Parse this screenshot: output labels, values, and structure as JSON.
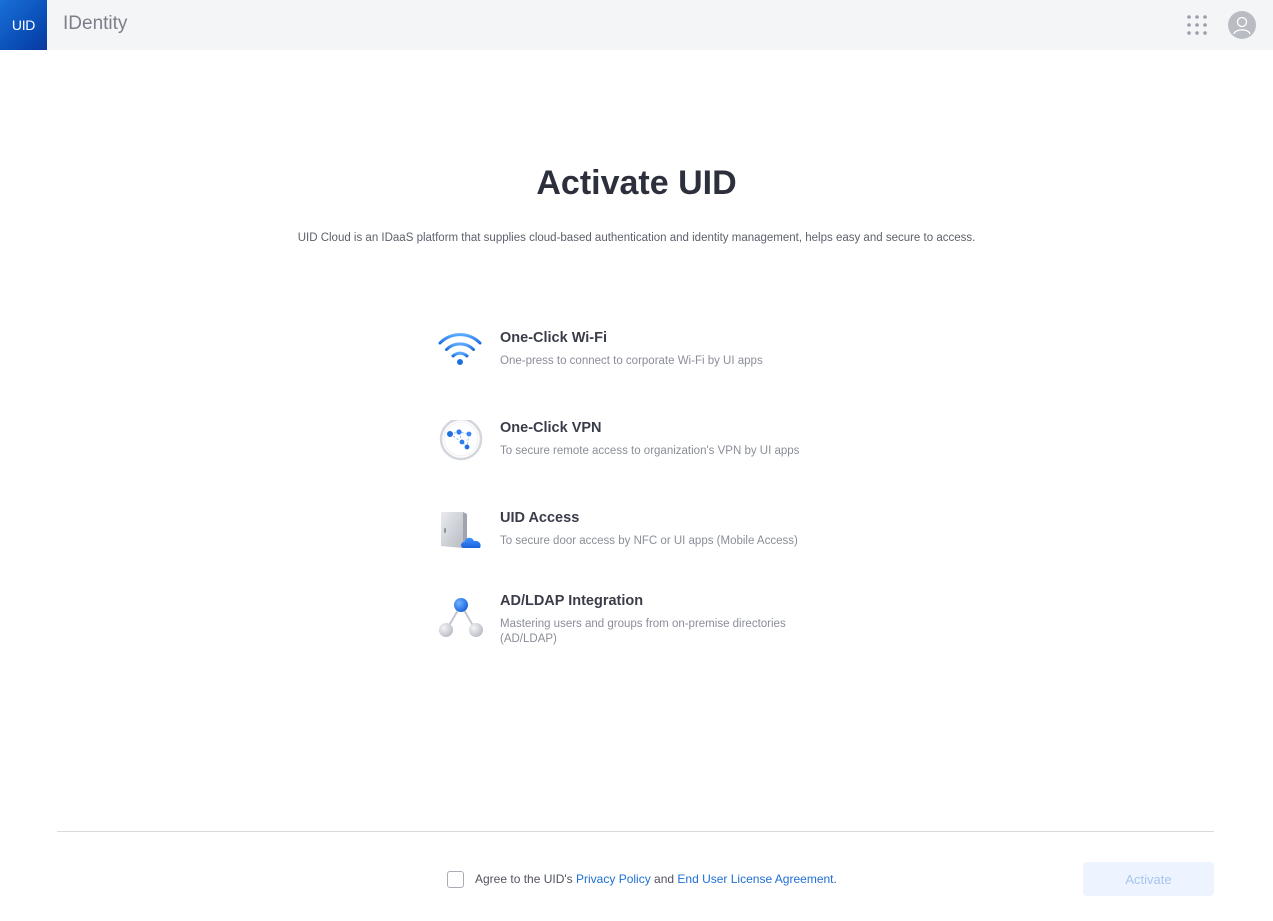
{
  "header": {
    "logo_text": "UID",
    "app_title": "IDentity",
    "icons": {
      "apps": "grid-dots-icon",
      "user": "user-avatar-icon"
    }
  },
  "hero": {
    "title": "Activate UID",
    "subtitle": "UID Cloud is an IDaaS platform that supplies cloud-based authentication and identity management, helps easy and secure to access."
  },
  "features": [
    {
      "icon": "wifi-icon",
      "title": "One-Click Wi-Fi",
      "description": "One-press to connect to corporate Wi-Fi by UI apps"
    },
    {
      "icon": "vpn-icon",
      "title": "One-Click VPN",
      "description": "To secure remote access to organization's VPN by UI apps"
    },
    {
      "icon": "door-cloud-icon",
      "title": "UID Access",
      "description": "To secure door access by NFC or UI apps (Mobile Access)"
    },
    {
      "icon": "directory-tree-icon",
      "title": "AD/LDAP Integration",
      "description": "Mastering users and groups from on-premise directories (AD/LDAP)"
    }
  ],
  "footer": {
    "agree_prefix": "Agree to the UID's ",
    "privacy_link": "Privacy Policy",
    "and_text": " and ",
    "eula_link": "End User License Agreement",
    "agree_suffix": ".",
    "checkbox_checked": false,
    "activate_label": "Activate"
  },
  "colors": {
    "accent": "#1f6fd6",
    "logo_blue": "#0a4fb8",
    "button_disabled_bg": "#edf4ff",
    "button_disabled_text": "#a8c4ee"
  }
}
